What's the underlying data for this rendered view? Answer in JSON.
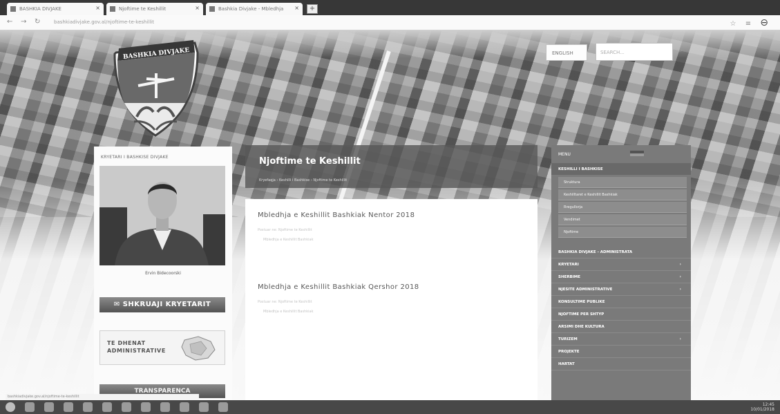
{
  "browser": {
    "tabs": [
      {
        "label": "BASHKIA DIVJAKE"
      },
      {
        "label": "Njoftime te Keshillit"
      },
      {
        "label": "Bashkia Divjake - Mbledhja"
      }
    ],
    "new_tab_glyph": "+",
    "url": "bashkiadivjake.gov.al/njoftime-te-keshillit",
    "nav_icons": [
      "back-icon",
      "forward-icon",
      "reload-icon"
    ],
    "right_icons": [
      "star-icon",
      "menu-icon",
      "user-icon"
    ]
  },
  "header": {
    "crest_text": "BASHKIA DIVJAKE",
    "button_label": "ENGLISH",
    "search_placeholder": "SEARCH..."
  },
  "left": {
    "heading": "KRYETARI I BASHKISE DIVJAKE",
    "mayor_name": "Ervin Bidecoorski",
    "contact_button": "SHKRUAJI KRYETARIT",
    "admin_line1": "TE DHENAT",
    "admin_line2": "ADMINISTRATIVE",
    "bottom_button": "TRANSPARENCA"
  },
  "main": {
    "title": "Njoftime te Keshillit",
    "breadcrumb": "Kryefaqja  ›  Keshilli i Bashkise  ›  Njoftime te Keshillit",
    "posts": [
      {
        "title": "Mbledhja e Keshillit Bashkiak Nentor 2018",
        "meta": "Postuar ne: Njoftime te Keshillit",
        "line": "Mbledhja e Keshillit Bashkiak"
      },
      {
        "title": "Mbledhja e Keshillit Bashkiak Qershor 2018",
        "meta": "Postuar ne: Njoftime te Keshillit",
        "line": "Mbledhja e Keshillit Bashkiak"
      }
    ]
  },
  "sidebar": {
    "top_label": "MENU",
    "section": "KESHILLI I BASHKISE",
    "subitems": [
      "Struktura",
      "Keshilltaret e Keshillit Bashkiak",
      "Rregullorja",
      "Vendimet",
      "Njoftime"
    ],
    "items": [
      "BASHKIA DIVJAKE - ADMINISTRATA",
      "KRYETARI",
      "SHERBIME",
      "NJESITE ADMINISTRATIVE",
      "KONSULTIME PUBLIKE",
      "NJOFTIME PER SHTYP",
      "ARSIMI DHE KULTURA",
      "TURIZEM",
      "PROJEKTE",
      "HARTAT"
    ]
  },
  "statusbar": {
    "url": "bashkiadivjake.gov.al/njoftime-te-keshillit"
  },
  "taskbar": {
    "time": "12:45",
    "date": "10/01/2018"
  }
}
